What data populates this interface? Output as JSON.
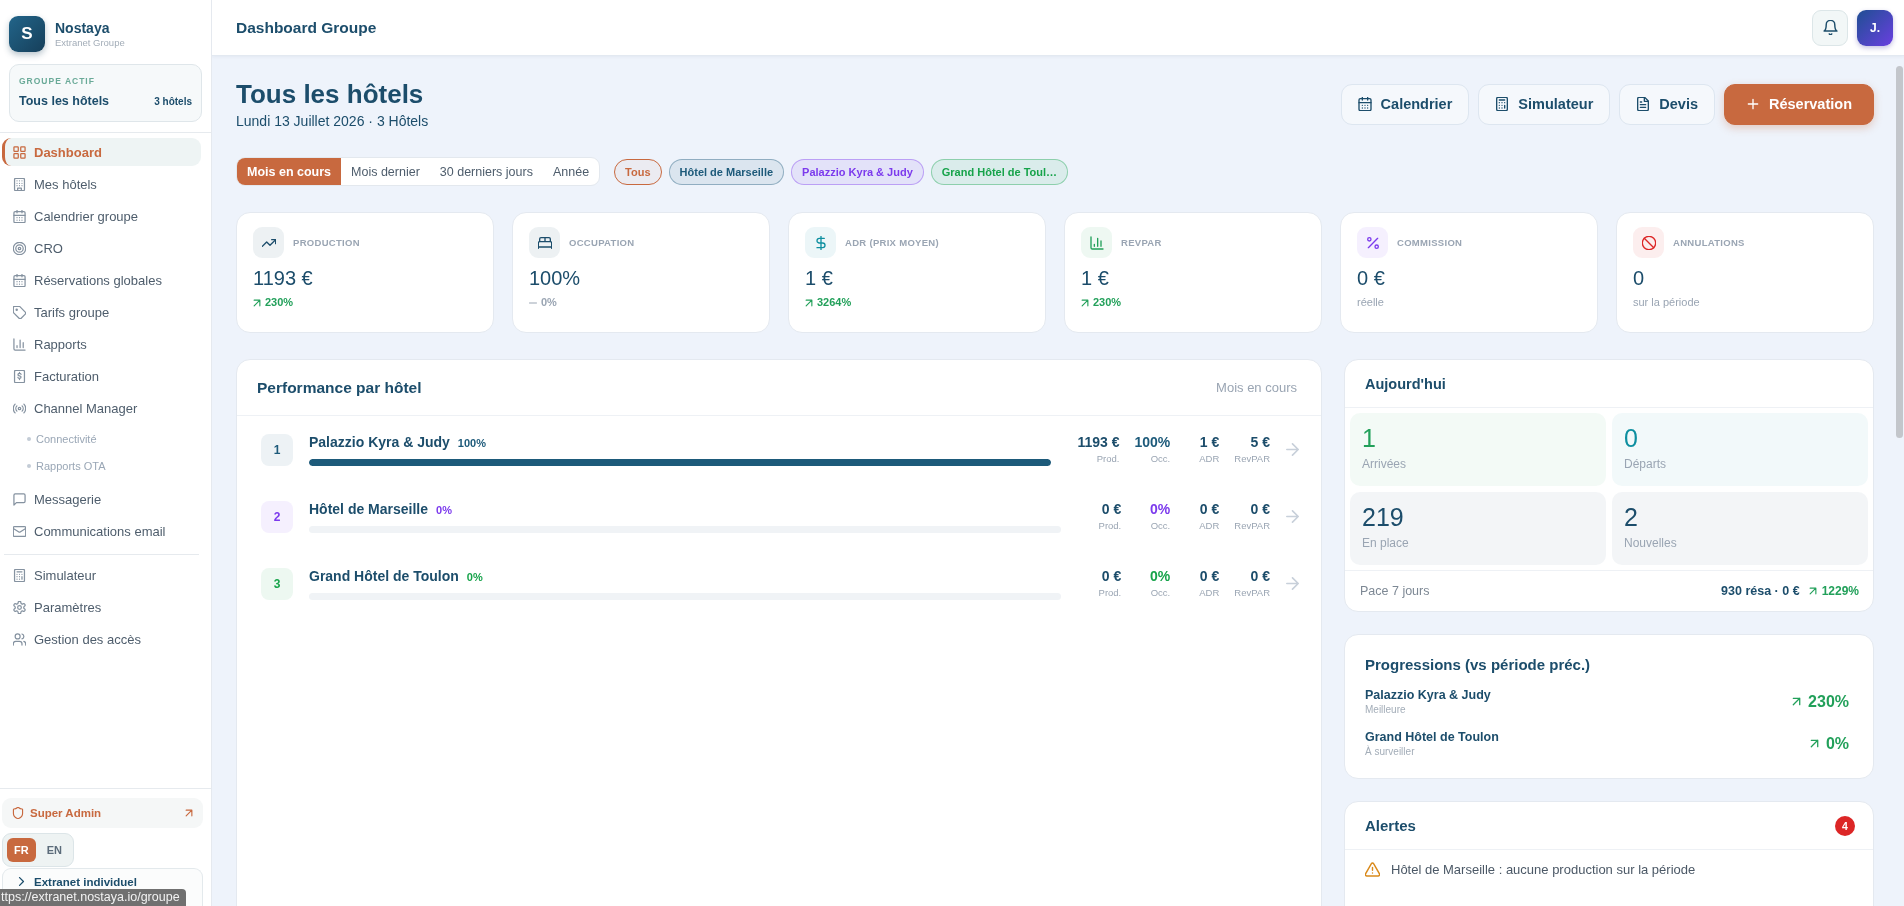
{
  "sidebar": {
    "brand": {
      "logo_letter": "S",
      "name": "Nostaya",
      "subtitle": "Extranet Groupe"
    },
    "active_group": {
      "label": "GROUPE ACTIF",
      "name": "Tous les hôtels",
      "count": "3 hôtels"
    },
    "nav_sections": [
      {
        "items": [
          {
            "label": "Dashboard",
            "selected": true
          },
          {
            "label": "Mes hôtels",
            "selected": false
          },
          {
            "label": "Calendrier groupe",
            "selected": false
          },
          {
            "label": "CRO",
            "selected": false
          },
          {
            "label": "Réservations globales",
            "selected": false
          },
          {
            "label": "Tarifs groupe",
            "selected": false
          },
          {
            "label": "Rapports",
            "selected": false
          },
          {
            "label": "Facturation",
            "selected": false
          },
          {
            "label": "Channel Manager",
            "selected": false,
            "children": [
              {
                "label": "Connectivité",
                "selected": false
              },
              {
                "label": "Rapports OTA",
                "selected": false
              }
            ]
          },
          {
            "label": "Messagerie",
            "selected": false
          },
          {
            "label": "Communications email",
            "selected": false
          }
        ]
      },
      {
        "items": [
          {
            "label": "Simulateur",
            "selected": false
          },
          {
            "label": "Paramètres",
            "selected": false
          },
          {
            "label": "Gestion des accès",
            "selected": false
          }
        ]
      }
    ],
    "admin_link": "Super Admin",
    "languages": [
      {
        "label": "FR",
        "selected": true
      },
      {
        "label": "EN",
        "selected": false
      }
    ],
    "extranet_link": "Extranet individuel"
  },
  "topbar": {
    "title": "Dashboard Groupe",
    "avatar_initials": "J."
  },
  "header": {
    "title": "Tous les hôtels",
    "subtitle": "Lundi 13 Juillet 2026 · 3 Hôtels",
    "actions": [
      {
        "label": "Calendrier",
        "kind": "secondary"
      },
      {
        "label": "Simulateur",
        "kind": "secondary"
      },
      {
        "label": "Devis",
        "kind": "secondary"
      },
      {
        "label": "Réservation",
        "kind": "primary"
      }
    ]
  },
  "period_tabs": [
    {
      "label": "Mois en cours",
      "selected": true
    },
    {
      "label": "Mois dernier",
      "selected": false
    },
    {
      "label": "30 derniers jours",
      "selected": false
    },
    {
      "label": "Année",
      "selected": false
    }
  ],
  "hotel_filters": [
    {
      "label": "Tous",
      "selected": true,
      "color": "#c8693f"
    },
    {
      "label": "Hôtel de Marseille",
      "selected": false,
      "color": "#1d5a7a"
    },
    {
      "label": "Palazzio Kyra & Judy",
      "selected": false,
      "color": "#7c3aed"
    },
    {
      "label": "Grand Hôtel de Toul…",
      "selected": false,
      "color": "#16a34a"
    }
  ],
  "kpis": [
    {
      "kind": "rising",
      "label": "PRODUCTION",
      "value": "1193 €",
      "note": "230%",
      "color": "#1c4d6b"
    },
    {
      "kind": "flat",
      "label": "OCCUPATION",
      "value": "100%",
      "note": "0%",
      "color": "#1c4d6b"
    },
    {
      "kind": "rising",
      "label": "ADR (PRIX MOYEN)",
      "value": "1 €",
      "note": "3264%",
      "color": "#0e8fa0"
    },
    {
      "kind": "rising",
      "label": "REVPAR",
      "value": "1 €",
      "note": "230%",
      "color": "#22a05a"
    },
    {
      "kind": "plain",
      "label": "COMMISSION",
      "value": "0 €",
      "note": "réelle",
      "color": "#7c3aed"
    },
    {
      "kind": "plain",
      "label": "ANNULATIONS",
      "value": "0",
      "note": "sur la période",
      "color": "#dc2626"
    }
  ],
  "performance": {
    "title": "Performance par hôtel",
    "period": "Mois en cours",
    "hotels": [
      {
        "rank": "1",
        "name": "Palazzio Kyra & Judy",
        "share": "100%",
        "level": 1,
        "color": "#1d5a7a",
        "metrics": [
          {
            "value": "1193 €",
            "label": "Prod.",
            "accent": false
          },
          {
            "value": "100%",
            "label": "Occ.",
            "accent": true
          },
          {
            "value": "1 €",
            "label": "ADR",
            "accent": false
          },
          {
            "value": "5 €",
            "label": "RevPAR",
            "accent": false
          }
        ]
      },
      {
        "rank": "2",
        "name": "Hôtel de Marseille",
        "share": "0%",
        "level": 0,
        "color": "#7c3aed",
        "metrics": [
          {
            "value": "0 €",
            "label": "Prod.",
            "accent": false
          },
          {
            "value": "0%",
            "label": "Occ.",
            "accent": true
          },
          {
            "value": "0 €",
            "label": "ADR",
            "accent": false
          },
          {
            "value": "0 €",
            "label": "RevPAR",
            "accent": false
          }
        ]
      },
      {
        "rank": "3",
        "name": "Grand Hôtel de Toulon",
        "share": "0%",
        "level": 0,
        "color": "#16a34a",
        "metrics": [
          {
            "value": "0 €",
            "label": "Prod.",
            "accent": false
          },
          {
            "value": "0%",
            "label": "Occ.",
            "accent": true
          },
          {
            "value": "0 €",
            "label": "ADR",
            "accent": false
          },
          {
            "value": "0 €",
            "label": "RevPAR",
            "accent": false
          }
        ]
      }
    ]
  },
  "today": {
    "title": "Aujourd'hui",
    "stats": [
      {
        "value": "1",
        "label": "Arrivées",
        "color": "#22a05a"
      },
      {
        "value": "0",
        "label": "Départs",
        "color": "#0e8fa0"
      },
      {
        "value": "219",
        "label": "En place",
        "color": "#1c4d6b"
      },
      {
        "value": "2",
        "label": "Nouvelles",
        "color": "#1c4d6b"
      }
    ],
    "pace": {
      "kind": "rising",
      "label": "Pace 7 jours",
      "summary": "930 résa · 0 €",
      "change": "1229%"
    }
  },
  "progressions": {
    "title": "Progressions (vs période préc.)",
    "items": [
      {
        "kind": "rising",
        "name": "Palazzio Kyra & Judy",
        "note": "Meilleure",
        "change": "230%"
      },
      {
        "kind": "rising",
        "name": "Grand Hôtel de Toulon",
        "note": "À surveiller",
        "change": "0%"
      }
    ]
  },
  "alerts": {
    "title": "Alertes",
    "count": "4",
    "items": [
      {
        "kind": "warning",
        "text": "Hôtel de Marseille : aucune production sur la période"
      }
    ]
  },
  "status_bubble": {
    "url": "ttps://extranet.nostaya.io/groupe"
  }
}
